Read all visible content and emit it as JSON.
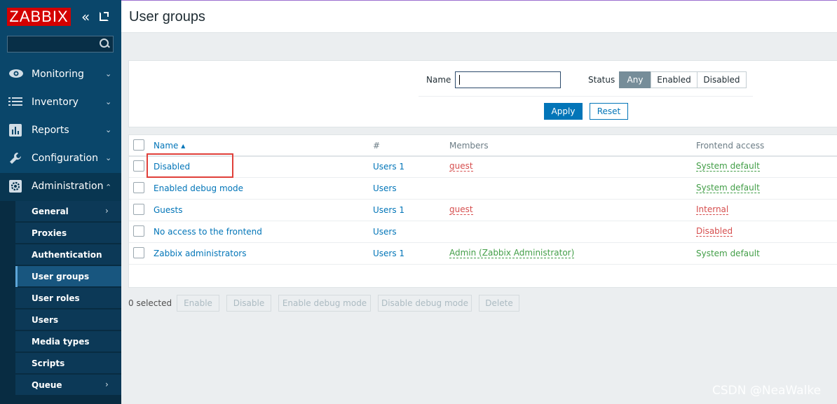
{
  "sidebar": {
    "logo": "ZABBIX",
    "search": {
      "value": "",
      "placeholder": ""
    },
    "menu": [
      {
        "label": "Monitoring",
        "icon": "eye-icon",
        "arrow": "⌄"
      },
      {
        "label": "Inventory",
        "icon": "list-icon",
        "arrow": "⌄"
      },
      {
        "label": "Reports",
        "icon": "bar-chart-icon",
        "arrow": "⌄"
      },
      {
        "label": "Configuration",
        "icon": "wrench-icon",
        "arrow": "⌄"
      },
      {
        "label": "Administration",
        "icon": "gear-icon",
        "arrow": "⌃"
      }
    ],
    "submenu": [
      {
        "label": "General",
        "has_children": true
      },
      {
        "label": "Proxies"
      },
      {
        "label": "Authentication"
      },
      {
        "label": "User groups",
        "active": true
      },
      {
        "label": "User roles"
      },
      {
        "label": "Users"
      },
      {
        "label": "Media types"
      },
      {
        "label": "Scripts"
      },
      {
        "label": "Queue",
        "has_children": true
      }
    ]
  },
  "header": {
    "title": "User groups"
  },
  "filter": {
    "name_label": "Name",
    "name_value": "",
    "status_label": "Status",
    "status_options": [
      "Any",
      "Enabled",
      "Disabled"
    ],
    "status_selected": "Any",
    "apply_label": "Apply",
    "reset_label": "Reset"
  },
  "table": {
    "columns": {
      "name": "Name ▴",
      "count": "#",
      "members": "Members",
      "frontend": "Frontend access"
    },
    "rows": [
      {
        "name": "Disabled",
        "users": "Users 1",
        "members": "guest",
        "frontend": "System default"
      },
      {
        "name": "Enabled debug mode",
        "users": "Users",
        "members": "",
        "frontend": "System default"
      },
      {
        "name": "Guests",
        "users": "Users 1",
        "members": "guest",
        "frontend": "Internal"
      },
      {
        "name": "No access to the frontend",
        "users": "Users",
        "members": "",
        "frontend": "Disabled"
      },
      {
        "name": "Zabbix administrators",
        "users": "Users 1",
        "members": "Admin (Zabbix Administrator)",
        "frontend": "System default"
      }
    ]
  },
  "actions": {
    "selected": "0 selected",
    "buttons": [
      "Enable",
      "Disable",
      "Enable debug mode",
      "Disable debug mode",
      "Delete"
    ]
  },
  "watermark": "CSDN @NeaWalke",
  "colors": {
    "sidebar": "#0a466a",
    "logo": "#d40000",
    "link": "#0275b8",
    "red": "#d64e4e",
    "green": "#429e47",
    "highlight": "#e0403a"
  }
}
